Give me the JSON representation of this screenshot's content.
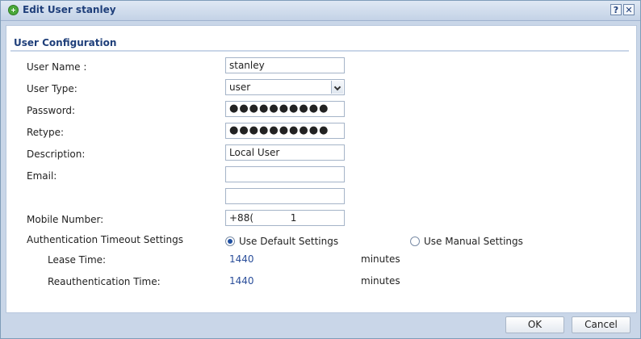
{
  "window": {
    "title": "Edit User stanley",
    "help_label": "?",
    "close_label": "✕"
  },
  "section": {
    "title": "User Configuration"
  },
  "form": {
    "user_name": {
      "label": "User Name :",
      "value": "stanley"
    },
    "user_type": {
      "label": "User Type:",
      "value": "user"
    },
    "password": {
      "label": "Password:",
      "value": "●●●●●●●●●●"
    },
    "retype": {
      "label": "Retype:",
      "value": "●●●●●●●●●●"
    },
    "description": {
      "label": "Description:",
      "value": "Local User"
    },
    "email": {
      "label": "Email:",
      "value_1": "",
      "value_2": ""
    },
    "mobile_number": {
      "label": "Mobile Number:",
      "value": "+88(            1"
    }
  },
  "auth_timeout": {
    "label": "Authentication Timeout Settings",
    "options": [
      {
        "label": "Use Default Settings",
        "selected": true
      },
      {
        "label": "Use Manual Settings",
        "selected": false
      }
    ],
    "lease_time": {
      "label": "Lease Time:",
      "value": "1440",
      "unit": "minutes"
    },
    "reauth_time": {
      "label": "Reauthentication Time:",
      "value": "1440",
      "unit": "minutes"
    }
  },
  "footer": {
    "ok_label": "OK",
    "cancel_label": "Cancel"
  },
  "colors": {
    "title_text": "#1f3f7a",
    "value_blue": "#2a4e9a",
    "frame_bg": "#c9d6e8"
  }
}
